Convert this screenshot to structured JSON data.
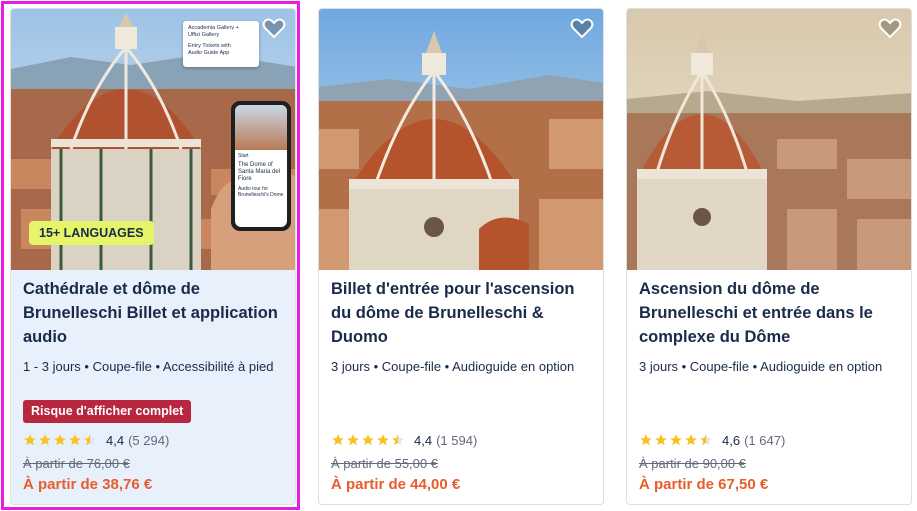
{
  "cards": [
    {
      "title": "Cathédrale et dôme de Brunelleschi Billet et application audio",
      "meta": "1 - 3 jours • Coupe-file • Accessibilité à pied",
      "badge": "Risque d'afficher complet",
      "rating": "4,4",
      "reviews": "(5 294)",
      "old_price": "À partir de 76,00 €",
      "new_price": "À partir de 38,76 €",
      "image_overlay": {
        "languages_badge": "15+ LANGUAGES",
        "ticket_lines": [
          "Accademia Gallery +",
          "Uffizi Gallery",
          "Entry Tickets with",
          "Audio Guide App"
        ],
        "phone_title": "The Dome of Santa Maria del Fiore",
        "phone_subtitle": "Audio tour for Brunelleschi's Dome",
        "phone_tab": "Start"
      },
      "selected": true
    },
    {
      "title": "Billet d'entrée pour l'ascension du dôme de Brunelleschi & Duomo",
      "meta": "3 jours • Coupe-file • Audioguide en option",
      "rating": "4,4",
      "reviews": "(1 594)",
      "old_price": "À partir de 55,00 €",
      "new_price": "À partir de 44,00 €"
    },
    {
      "title": "Ascension du dôme de Brunelleschi et entrée dans le complexe du Dôme",
      "meta": "3 jours • Coupe-file • Audioguide en option",
      "rating": "4,6",
      "reviews": "(1 647)",
      "old_price": "À partir de 90,00 €",
      "new_price": "À partir de 67,50 €"
    }
  ],
  "icons": {
    "favorite": "heart-outline-icon",
    "star": "star-icon"
  },
  "colors": {
    "title": "#1a2b49",
    "badge_bg": "#b8263f",
    "price_new": "#e85d2c",
    "star": "#f7c11e",
    "selection_outline": "#e81ce0",
    "selected_card_bg": "#e7f0fb"
  }
}
